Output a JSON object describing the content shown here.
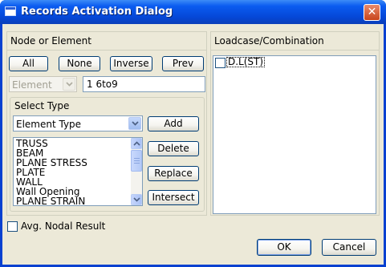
{
  "window": {
    "title": "Records Activation Dialog",
    "close_glyph": "✕"
  },
  "node_panel": {
    "title": "Node or Element",
    "buttons": {
      "all": "All",
      "none": "None",
      "inverse": "Inverse",
      "prev": "Prev"
    },
    "mode_combo": "Element",
    "selection_input": "1 6to9"
  },
  "select_type": {
    "title": "Select Type",
    "type_combo": "Element Type",
    "add": "Add",
    "delete": "Delete",
    "replace": "Replace",
    "intersect": "Intersect",
    "items": [
      "TRUSS",
      "BEAM",
      "PLANE STRESS",
      "PLATE",
      "WALL",
      "Wall Opening",
      "PLANE STRAIN"
    ]
  },
  "avg_nodal": {
    "label": "Avg. Nodal Result",
    "checked": false
  },
  "loadcase": {
    "title": "Loadcase/Combination",
    "items": [
      {
        "label": "D.L(ST)",
        "checked": false
      }
    ]
  },
  "footer": {
    "ok": "OK",
    "cancel": "Cancel"
  },
  "colors": {
    "titlebar": "#0b5cf0",
    "dialog_bg": "#ece9d8",
    "button_border": "#003c74",
    "close_button": "#c8441c"
  }
}
